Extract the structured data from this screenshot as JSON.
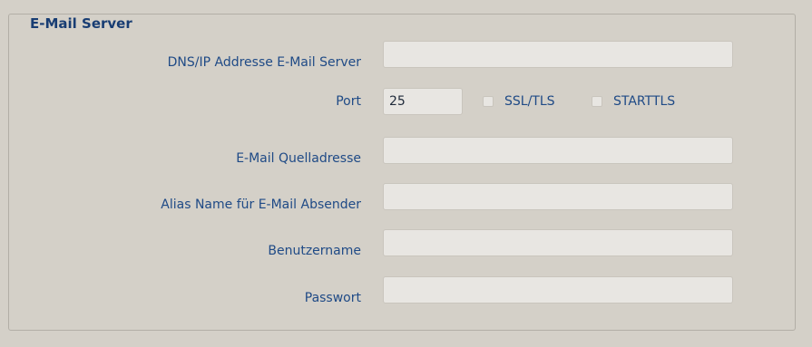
{
  "email_server": {
    "legend": "E-Mail Server",
    "host": {
      "label": "DNS/IP Addresse E-Mail Server",
      "value": ""
    },
    "port": {
      "label": "Port",
      "value": "25"
    },
    "ssl": {
      "label": "SSL/TLS",
      "checked": false
    },
    "starttls": {
      "label": "STARTTLS",
      "checked": false
    },
    "source_address": {
      "label": "E-Mail Quelladresse",
      "value": ""
    },
    "alias": {
      "label": "Alias Name für E-Mail Absender",
      "value": ""
    },
    "username": {
      "label": "Benutzername",
      "value": ""
    },
    "password": {
      "label": "Passwort",
      "value": ""
    }
  },
  "colors": {
    "background": "#d4d0c8",
    "label": "#1f4a86",
    "legend": "#183d73",
    "field": "#e8e6e2"
  }
}
